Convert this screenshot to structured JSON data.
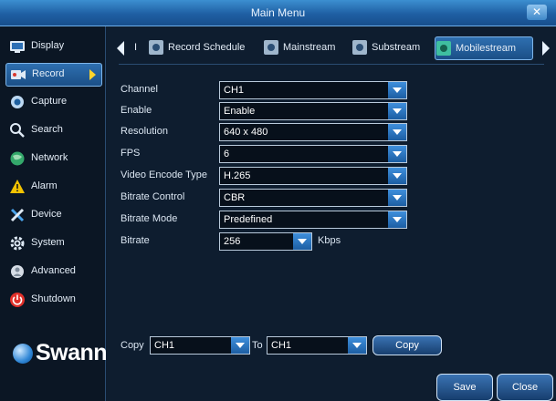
{
  "window": {
    "title": "Main Menu",
    "close_glyph": "✕"
  },
  "sidebar": {
    "items": [
      {
        "label": "Display",
        "icon": "display-icon"
      },
      {
        "label": "Record",
        "icon": "record-icon"
      },
      {
        "label": "Capture",
        "icon": "camera-icon"
      },
      {
        "label": "Search",
        "icon": "search-icon"
      },
      {
        "label": "Network",
        "icon": "globe-icon"
      },
      {
        "label": "Alarm",
        "icon": "warning-icon"
      },
      {
        "label": "Device",
        "icon": "tools-icon"
      },
      {
        "label": "System",
        "icon": "gear-icon"
      },
      {
        "label": "Advanced",
        "icon": "advanced-icon"
      },
      {
        "label": "Shutdown",
        "icon": "power-icon"
      }
    ],
    "active_index": 1
  },
  "brand": {
    "name": "Swann"
  },
  "tabs": {
    "items": [
      {
        "label": "Record Schedule"
      },
      {
        "label": "Mainstream"
      },
      {
        "label": "Substream"
      },
      {
        "label": "Mobilestream"
      }
    ],
    "truncated_left": "I",
    "active_index": 3
  },
  "form": {
    "fields": [
      {
        "label": "Channel",
        "value": "CH1"
      },
      {
        "label": "Enable",
        "value": "Enable"
      },
      {
        "label": "Resolution",
        "value": "640 x 480"
      },
      {
        "label": "FPS",
        "value": "6"
      },
      {
        "label": "Video Encode Type",
        "value": "H.265"
      },
      {
        "label": "Bitrate Control",
        "value": "CBR"
      },
      {
        "label": "Bitrate Mode",
        "value": "Predefined"
      }
    ],
    "bitrate": {
      "label": "Bitrate",
      "value": "256",
      "unit": "Kbps"
    }
  },
  "copy": {
    "label": "Copy",
    "from_value": "CH1",
    "to_label": "To",
    "to_value": "CH1",
    "button_label": "Copy"
  },
  "footer": {
    "save_label": "Save",
    "close_label": "Close"
  },
  "colors": {
    "accent": "#2f7fd0",
    "active_tab_icon": "#3fbfa0",
    "record_arrow": "#ffd42b",
    "alarm": "#f2c200",
    "shutdown": "#e0302a"
  }
}
